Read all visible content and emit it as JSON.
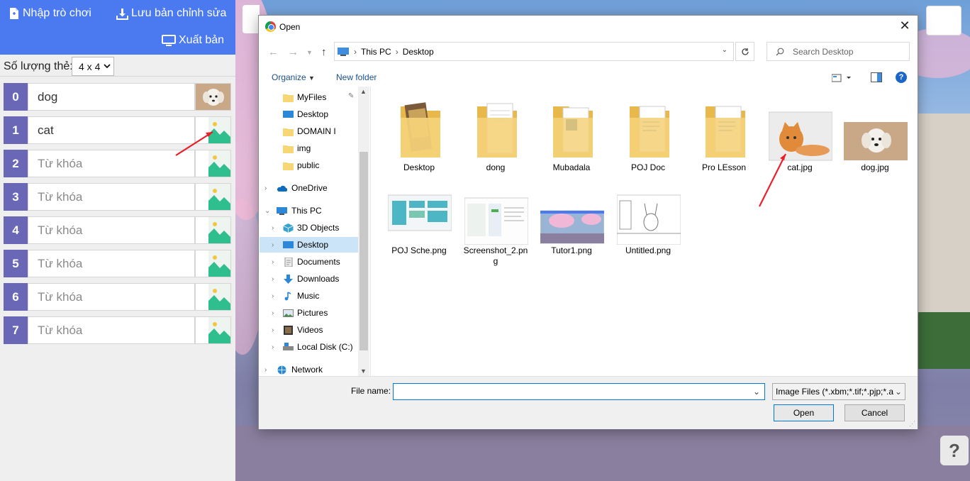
{
  "editor": {
    "import_label": "Nhập trò chơi",
    "save_label": "Lưu bản chỉnh sửa",
    "export_label": "Xuất bản",
    "count_label": "Số lượng thẻ:",
    "count_value": "4 x 4",
    "cards": [
      {
        "index": "0",
        "text": "dog",
        "placeholder": false
      },
      {
        "index": "1",
        "text": "cat",
        "placeholder": false
      },
      {
        "index": "2",
        "text": "Từ khóa",
        "placeholder": true
      },
      {
        "index": "3",
        "text": "Từ khóa",
        "placeholder": true
      },
      {
        "index": "4",
        "text": "Từ khóa",
        "placeholder": true
      },
      {
        "index": "5",
        "text": "Từ khóa",
        "placeholder": true
      },
      {
        "index": "6",
        "text": "Từ khóa",
        "placeholder": true
      },
      {
        "index": "7",
        "text": "Từ khóa",
        "placeholder": true
      }
    ]
  },
  "dialog": {
    "title": "Open",
    "path": [
      "This PC",
      "Desktop"
    ],
    "search_placeholder": "Search Desktop",
    "organize_label": "Organize",
    "new_folder_label": "New folder",
    "nav": [
      {
        "label": "MyFiles",
        "icon": "folder-icon",
        "pinned": true
      },
      {
        "label": "Desktop",
        "icon": "desktop-icon"
      },
      {
        "label": "DOMAIN I",
        "icon": "folder-icon"
      },
      {
        "label": "img",
        "icon": "folder-icon"
      },
      {
        "label": "public",
        "icon": "folder-icon"
      },
      {
        "label": "OneDrive",
        "icon": "cloud-icon"
      },
      {
        "label": "This PC",
        "icon": "computer-icon"
      },
      {
        "label": "3D Objects",
        "icon": "cube-icon"
      },
      {
        "label": "Desktop",
        "icon": "desktop-icon"
      },
      {
        "label": "Documents",
        "icon": "document-icon"
      },
      {
        "label": "Downloads",
        "icon": "download-icon"
      },
      {
        "label": "Music",
        "icon": "music-icon"
      },
      {
        "label": "Pictures",
        "icon": "picture-icon"
      },
      {
        "label": "Videos",
        "icon": "video-icon"
      },
      {
        "label": "Local Disk (C:)",
        "icon": "drive-icon"
      },
      {
        "label": "Network",
        "icon": "network-icon"
      }
    ],
    "files": [
      {
        "name": "Desktop",
        "kind": "folder-photos"
      },
      {
        "name": "dong",
        "kind": "folder-docs"
      },
      {
        "name": "Mubadala",
        "kind": "folder-word"
      },
      {
        "name": "POJ Doc",
        "kind": "folder-docs"
      },
      {
        "name": "Pro LEsson",
        "kind": "folder-docs"
      },
      {
        "name": "cat.jpg",
        "kind": "image-cat"
      },
      {
        "name": "dog.jpg",
        "kind": "image-dog"
      },
      {
        "name": "POJ Sche.png",
        "kind": "image-diagram"
      },
      {
        "name": "Screenshot_2.png",
        "kind": "image-screenshot"
      },
      {
        "name": "Tutor1.png",
        "kind": "image-scene"
      },
      {
        "name": "Untitled.png",
        "kind": "image-sketch"
      }
    ],
    "file_name_label": "File name:",
    "file_name_value": "",
    "filter_value": "Image Files (*.xbm;*.tif;*.pjp;*.a",
    "open_label": "Open",
    "cancel_label": "Cancel"
  },
  "colors": {
    "toolbar": "#4a79f0",
    "index_badge": "#6a68b6",
    "annotation_arrow": "#e8202a",
    "selection": "#cce4f7"
  }
}
